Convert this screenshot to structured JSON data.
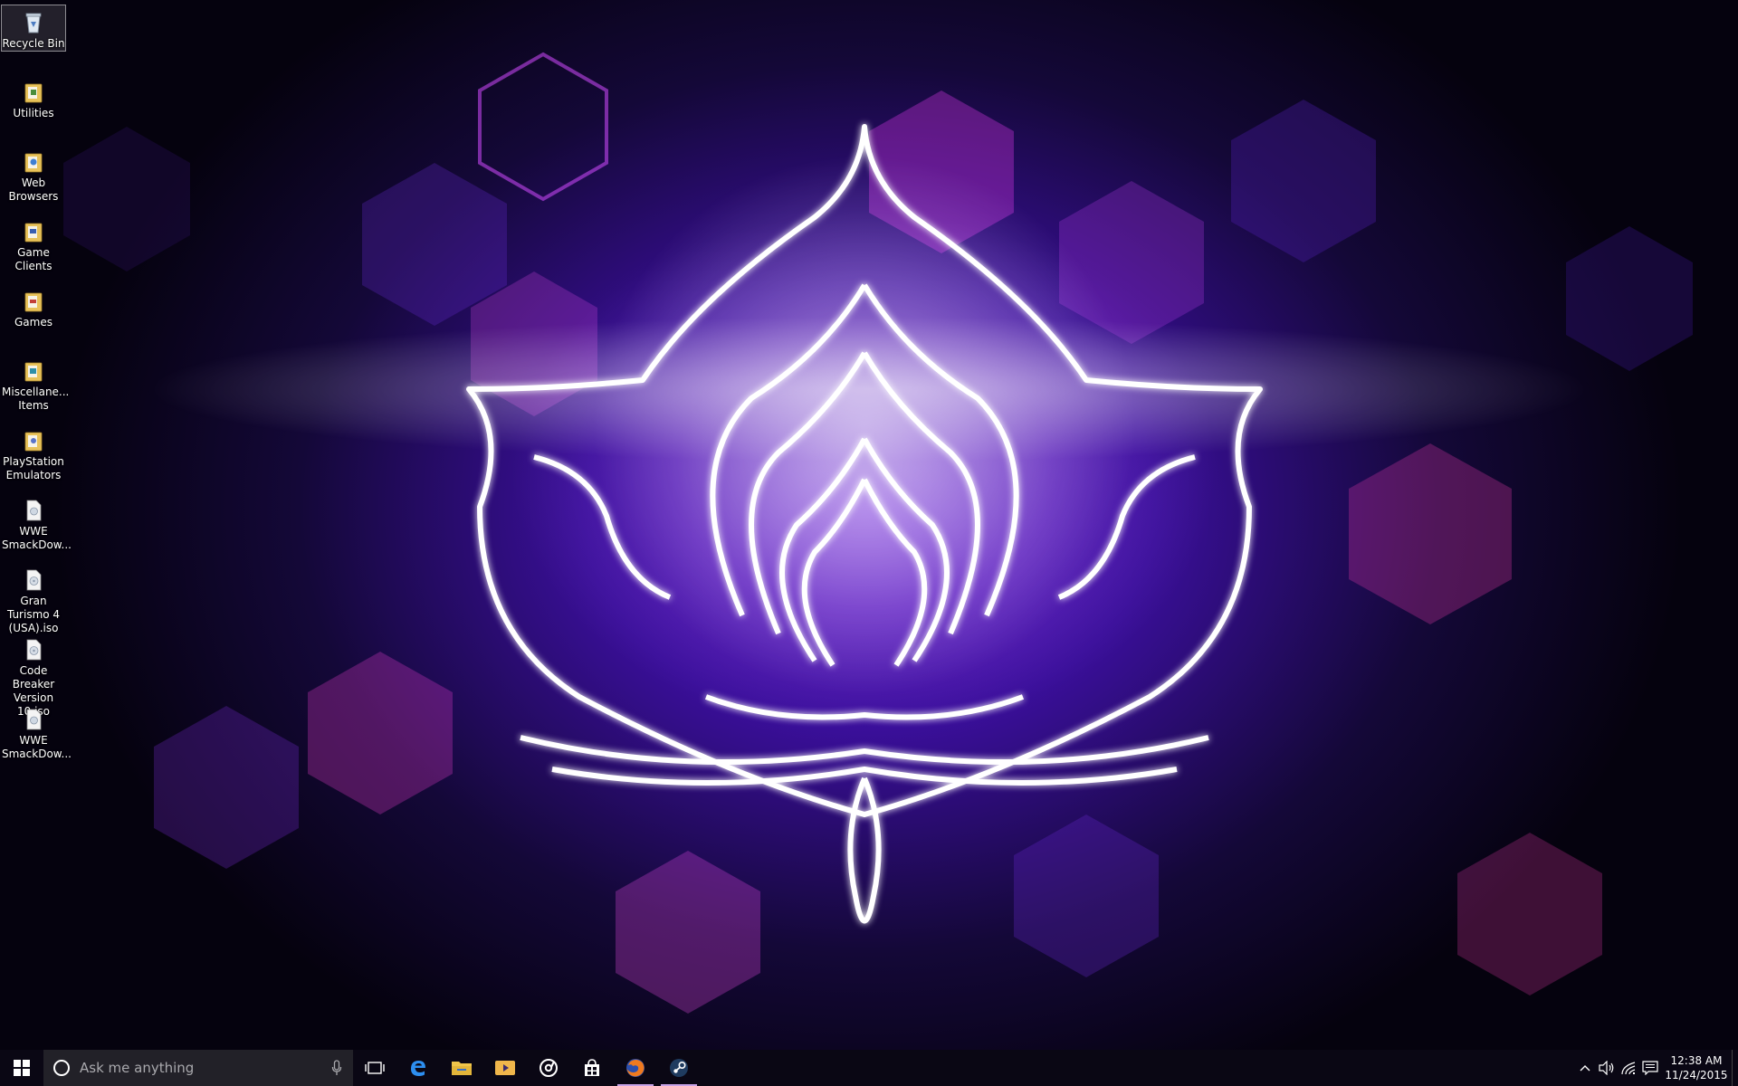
{
  "desktop": {
    "icons": [
      {
        "label": "Recycle Bin",
        "icon": "recycle-bin-icon"
      },
      {
        "label": "Utilities",
        "icon": "folder-icon"
      },
      {
        "label": "Web Browsers",
        "icon": "folder-icon"
      },
      {
        "label": "Game Clients",
        "icon": "folder-icon"
      },
      {
        "label": "Games",
        "icon": "folder-icon"
      },
      {
        "label": "Miscellane... Items",
        "icon": "folder-icon"
      },
      {
        "label": "PlayStation Emulators",
        "icon": "folder-icon"
      },
      {
        "label": "WWE SmackDow...",
        "icon": "file-icon"
      },
      {
        "label": "Gran Turismo 4 (USA).iso",
        "icon": "disc-image-icon"
      },
      {
        "label": "Code Breaker Version 10.iso",
        "icon": "disc-image-icon"
      },
      {
        "label": "WWE SmackDow...",
        "icon": "file-icon"
      }
    ]
  },
  "taskbar": {
    "search_placeholder": "Ask me anything",
    "pinned": [
      {
        "name": "task-view",
        "icon": "task-view-icon"
      },
      {
        "name": "edge",
        "icon": "edge-icon"
      },
      {
        "name": "file-explorer",
        "icon": "folder-icon"
      },
      {
        "name": "media-player",
        "icon": "media-player-icon"
      },
      {
        "name": "groove",
        "icon": "disc-icon"
      },
      {
        "name": "store",
        "icon": "store-icon"
      },
      {
        "name": "firefox",
        "icon": "firefox-icon"
      },
      {
        "name": "steam",
        "icon": "steam-icon"
      }
    ],
    "clock": {
      "time": "12:38 AM",
      "date": "11/24/2015"
    }
  },
  "colors": {
    "accent": "#7a2cf0",
    "wallpaper_glow": "#ff4de8",
    "taskbar_bg": "#0a0714",
    "search_bg": "#222128"
  }
}
